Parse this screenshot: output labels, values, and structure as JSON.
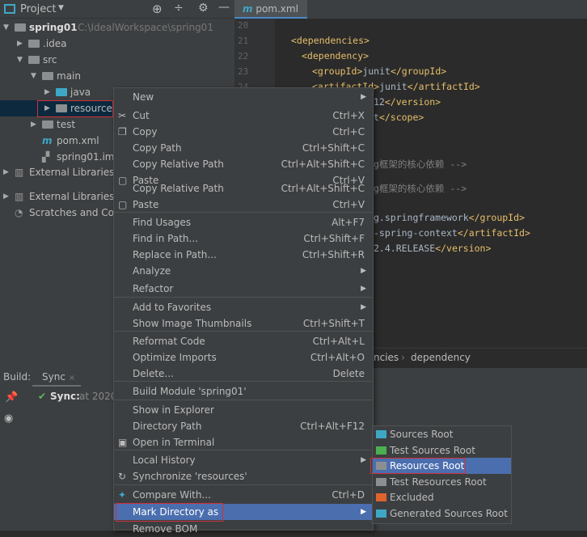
{
  "project_panel": {
    "title": "Project",
    "tree": [
      {
        "label": "spring01",
        "path": "C:\\IdealWorkspace\\spring01",
        "depth": 0,
        "expanded": true,
        "icon": "module-folder-icon"
      },
      {
        "label": ".idea",
        "depth": 1,
        "expanded": false,
        "icon": "folder-icon"
      },
      {
        "label": "src",
        "depth": 1,
        "expanded": true,
        "icon": "folder-icon"
      },
      {
        "label": "main",
        "depth": 2,
        "expanded": true,
        "icon": "folder-icon"
      },
      {
        "label": "java",
        "depth": 3,
        "expanded": false,
        "icon": "source-folder-icon"
      },
      {
        "label": "resources",
        "depth": 3,
        "expanded": false,
        "icon": "folder-icon",
        "selected": true
      },
      {
        "label": "test",
        "depth": 2,
        "expanded": false,
        "icon": "folder-icon"
      },
      {
        "label": "pom.xml",
        "depth": 2,
        "icon": "maven-icon"
      },
      {
        "label": "spring01.iml",
        "depth": 2,
        "icon": "iml-file-icon"
      },
      {
        "label": "External Libraries",
        "depth": 0,
        "expanded": false,
        "icon": "libraries-icon"
      },
      {
        "label": "External Libraries",
        "depth": 0,
        "expanded": false,
        "icon": "libraries-icon"
      },
      {
        "label": "Scratches and Cons",
        "depth": 0,
        "icon": "scratches-icon"
      }
    ]
  },
  "editor": {
    "tab": "pom.xml",
    "line_numbers": [
      "20",
      "21",
      "22",
      "23",
      "24"
    ],
    "lines": [
      {
        "tag": "<dependencies>"
      },
      {
        "tag": "<dependency>"
      },
      {
        "open": "<groupId>",
        "text": "junit",
        "close": "</groupId>"
      },
      {
        "open": "<artifactId>",
        "text": "junit",
        "close": "</artifactId>"
      },
      {
        "text": "12",
        "close": "</version>"
      },
      {
        "text": "t",
        "close": "</scope>"
      },
      {
        "comment": "g框架的核心依赖 -->"
      },
      {
        "comment": "g框架的核心依赖 -->"
      },
      {
        "text": "g.springframework",
        "close": "</groupId>"
      },
      {
        "text": "-spring-context",
        "close": "</artifactId>"
      },
      {
        "text": "2.4.RELEASE",
        "close": "</version>"
      }
    ],
    "breadcrumb": [
      "ncies",
      "dependency"
    ]
  },
  "build_panel": {
    "label": "Build:",
    "tab": "Sync",
    "status_label": "Sync:",
    "status_text": "at 2020/"
  },
  "context_menu": {
    "items": [
      {
        "label": "New",
        "submenu": true
      },
      {
        "label": "Cut",
        "shortcut": "Ctrl+X",
        "icon": "scissors-icon"
      },
      {
        "label": "Copy",
        "shortcut": "Ctrl+C",
        "icon": "copy-icon"
      },
      {
        "label": "Copy Path",
        "shortcut": "Ctrl+Shift+C"
      },
      {
        "label": "Copy Relative Path",
        "shortcut": "Ctrl+Alt+Shift+C"
      },
      {
        "label": "Paste",
        "shortcut": "Ctrl+V",
        "icon": "paste-icon"
      },
      {
        "label": "Copy Relative Path",
        "shortcut": "Ctrl+Alt+Shift+C"
      },
      {
        "label": "Paste",
        "shortcut": "Ctrl+V",
        "icon": "paste-icon"
      },
      {
        "label": "Find Usages",
        "shortcut": "Alt+F7"
      },
      {
        "label": "Find in Path...",
        "shortcut": "Ctrl+Shift+F"
      },
      {
        "label": "Replace in Path...",
        "shortcut": "Ctrl+Shift+R"
      },
      {
        "label": "Analyze",
        "submenu": true
      },
      {
        "label": "Refactor",
        "submenu": true
      },
      {
        "label": "Add to Favorites",
        "submenu": true
      },
      {
        "label": "Show Image Thumbnails",
        "shortcut": "Ctrl+Shift+T"
      },
      {
        "label": "Reformat Code",
        "shortcut": "Ctrl+Alt+L"
      },
      {
        "label": "Optimize Imports",
        "shortcut": "Ctrl+Alt+O"
      },
      {
        "label": "Delete...",
        "shortcut": "Delete"
      },
      {
        "label": "Build Module 'spring01'"
      },
      {
        "label": "Show in Explorer"
      },
      {
        "label": "Directory Path",
        "shortcut": "Ctrl+Alt+F12"
      },
      {
        "label": "Open in Terminal",
        "icon": "terminal-icon"
      },
      {
        "label": "Local History",
        "submenu": true
      },
      {
        "label": "Synchronize 'resources'",
        "icon": "sync-icon"
      },
      {
        "label": "Compare With...",
        "shortcut": "Ctrl+D",
        "icon": "compare-icon"
      },
      {
        "label": "Mark Directory as",
        "submenu": true,
        "highlighted": true
      },
      {
        "label": "Remove BOM"
      }
    ]
  },
  "submenu": {
    "items": [
      {
        "label": "Sources Root",
        "color": "#3fa7c6"
      },
      {
        "label": "Test Sources Root",
        "color": "#4caf50"
      },
      {
        "label": "Resources Root",
        "color": "#8c8f91",
        "highlighted": true
      },
      {
        "label": "Test Resources Root",
        "color": "#8c8f91"
      },
      {
        "label": "Excluded",
        "color": "#e0632e"
      },
      {
        "label": "Generated Sources Root",
        "color": "#3fa7c6"
      }
    ]
  },
  "colors": {
    "selection": "#4b6eaf",
    "highlight_box": "#d0303a",
    "tree_selection": "#0d293e"
  }
}
